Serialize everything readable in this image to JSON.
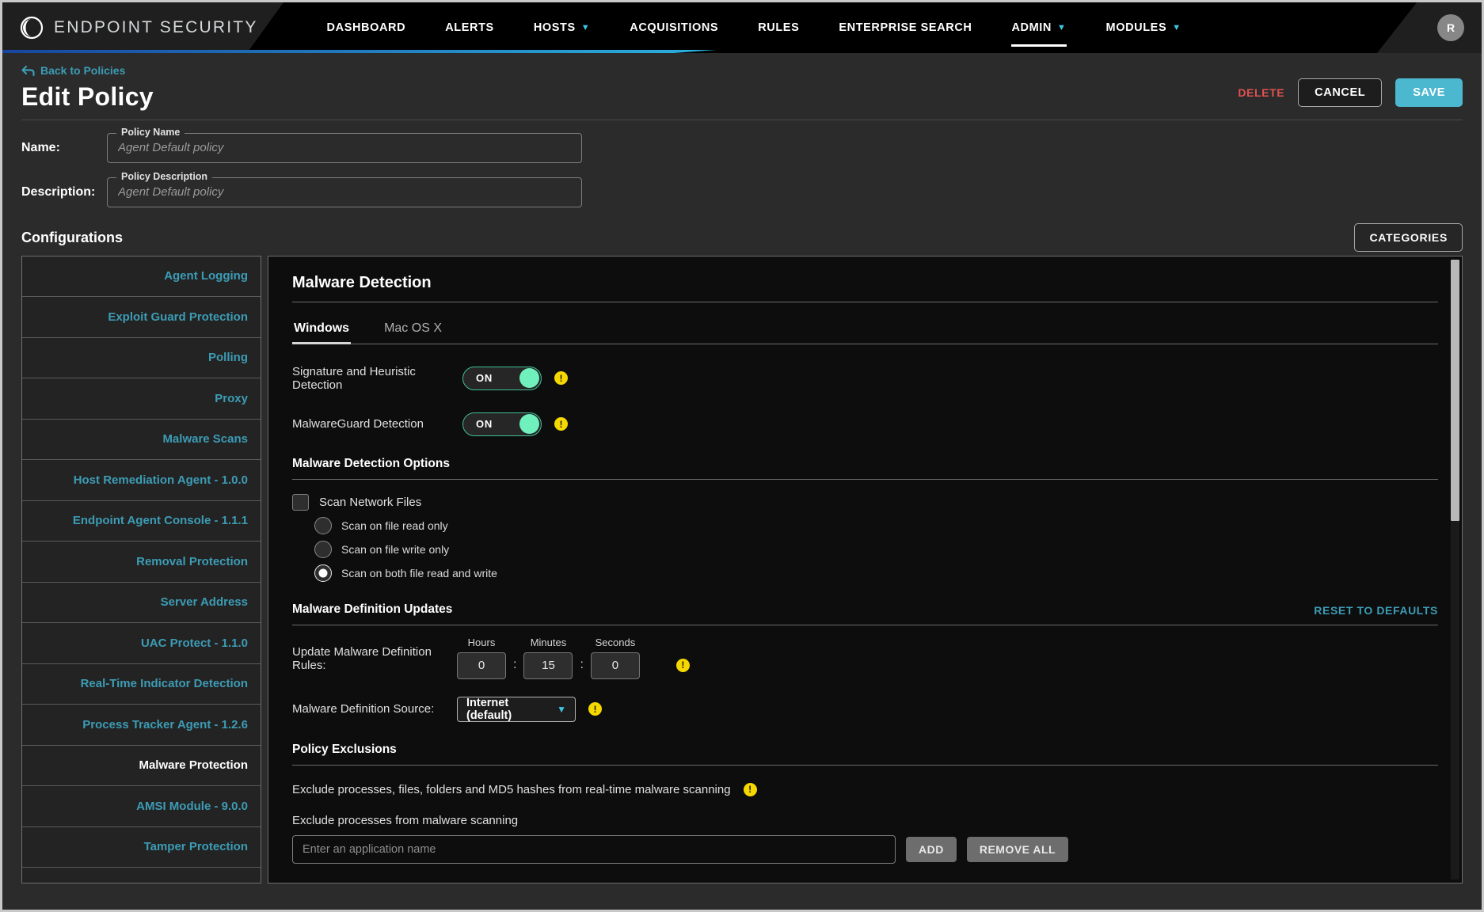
{
  "brand": {
    "name": "ENDPOINT SECURITY",
    "logo_icon": "shield-logo-icon"
  },
  "topnav": {
    "items": [
      {
        "label": "DASHBOARD",
        "has_caret": false,
        "active": false
      },
      {
        "label": "ALERTS",
        "has_caret": false,
        "active": false
      },
      {
        "label": "HOSTS",
        "has_caret": true,
        "active": false
      },
      {
        "label": "ACQUISITIONS",
        "has_caret": false,
        "active": false
      },
      {
        "label": "RULES",
        "has_caret": false,
        "active": false
      },
      {
        "label": "ENTERPRISE SEARCH",
        "has_caret": false,
        "active": false
      },
      {
        "label": "ADMIN",
        "has_caret": true,
        "active": true
      },
      {
        "label": "MODULES",
        "has_caret": true,
        "active": false
      }
    ],
    "avatar_initial": "R"
  },
  "page": {
    "back_link": "Back to Policies",
    "title": "Edit Policy",
    "delete_label": "DELETE",
    "cancel_label": "CANCEL",
    "save_label": "SAVE"
  },
  "form": {
    "name_label": "Name:",
    "name_legend": "Policy Name",
    "name_value": "",
    "name_placeholder": "Agent Default policy",
    "description_label": "Description:",
    "description_legend": "Policy Description",
    "description_value": "",
    "description_placeholder": "Agent Default policy"
  },
  "configurations": {
    "heading": "Configurations",
    "categories_label": "CATEGORIES",
    "items": [
      {
        "label": "Agent Logging",
        "selected": false
      },
      {
        "label": "Exploit Guard Protection",
        "selected": false
      },
      {
        "label": "Polling",
        "selected": false
      },
      {
        "label": "Proxy",
        "selected": false
      },
      {
        "label": "Malware Scans",
        "selected": false
      },
      {
        "label": "Host Remediation Agent - 1.0.0",
        "selected": false
      },
      {
        "label": "Endpoint Agent Console - 1.1.1",
        "selected": false
      },
      {
        "label": "Removal Protection",
        "selected": false
      },
      {
        "label": "Server Address",
        "selected": false
      },
      {
        "label": "UAC Protect - 1.1.0",
        "selected": false
      },
      {
        "label": "Real-Time Indicator Detection",
        "selected": false
      },
      {
        "label": "Process Tracker Agent - 1.2.6",
        "selected": false
      },
      {
        "label": "Malware Protection",
        "selected": true
      },
      {
        "label": "AMSI Module - 9.0.0",
        "selected": false
      },
      {
        "label": "Tamper Protection",
        "selected": false
      },
      {
        "label": "",
        "selected": false
      }
    ]
  },
  "panel": {
    "title": "Malware Detection",
    "tabs": [
      {
        "label": "Windows",
        "active": true
      },
      {
        "label": "Mac OS X",
        "active": false
      }
    ],
    "toggles": [
      {
        "label": "Signature and Heuristic Detection",
        "state": "ON"
      },
      {
        "label": "MalwareGuard Detection",
        "state": "ON"
      }
    ],
    "detection_options": {
      "heading": "Malware Detection Options",
      "checkbox_label": "Scan Network Files",
      "checkbox_checked": false,
      "radios": [
        {
          "label": "Scan on file read only",
          "checked": false
        },
        {
          "label": "Scan on file write only",
          "checked": false
        },
        {
          "label": "Scan on both file read and write",
          "checked": true
        }
      ]
    },
    "definition_updates": {
      "heading": "Malware Definition Updates",
      "reset_label": "RESET TO DEFAULTS",
      "row_label": "Update Malware Definition Rules:",
      "hours_label": "Hours",
      "minutes_label": "Minutes",
      "seconds_label": "Seconds",
      "hours_value": "0",
      "minutes_value": "15",
      "seconds_value": "0",
      "separator": ":",
      "source_label": "Malware Definition Source:",
      "source_value": "Internet (default)"
    },
    "policy_exclusions": {
      "heading": "Policy Exclusions",
      "note": "Exclude processes, files, folders and MD5 hashes from real-time malware scanning",
      "sub_label": "Exclude processes from malware scanning",
      "input_value": "",
      "input_placeholder": "Enter an application name",
      "add_label": "ADD",
      "remove_all_label": "REMOVE ALL"
    }
  },
  "colors": {
    "accent_teal": "#3c9cb5",
    "accent_cyan": "#3fc6e0",
    "save_button": "#4cb8cf",
    "delete_red": "#e05252",
    "toggle_green": "#6ff0bd",
    "warning_yellow": "#f5d800"
  }
}
